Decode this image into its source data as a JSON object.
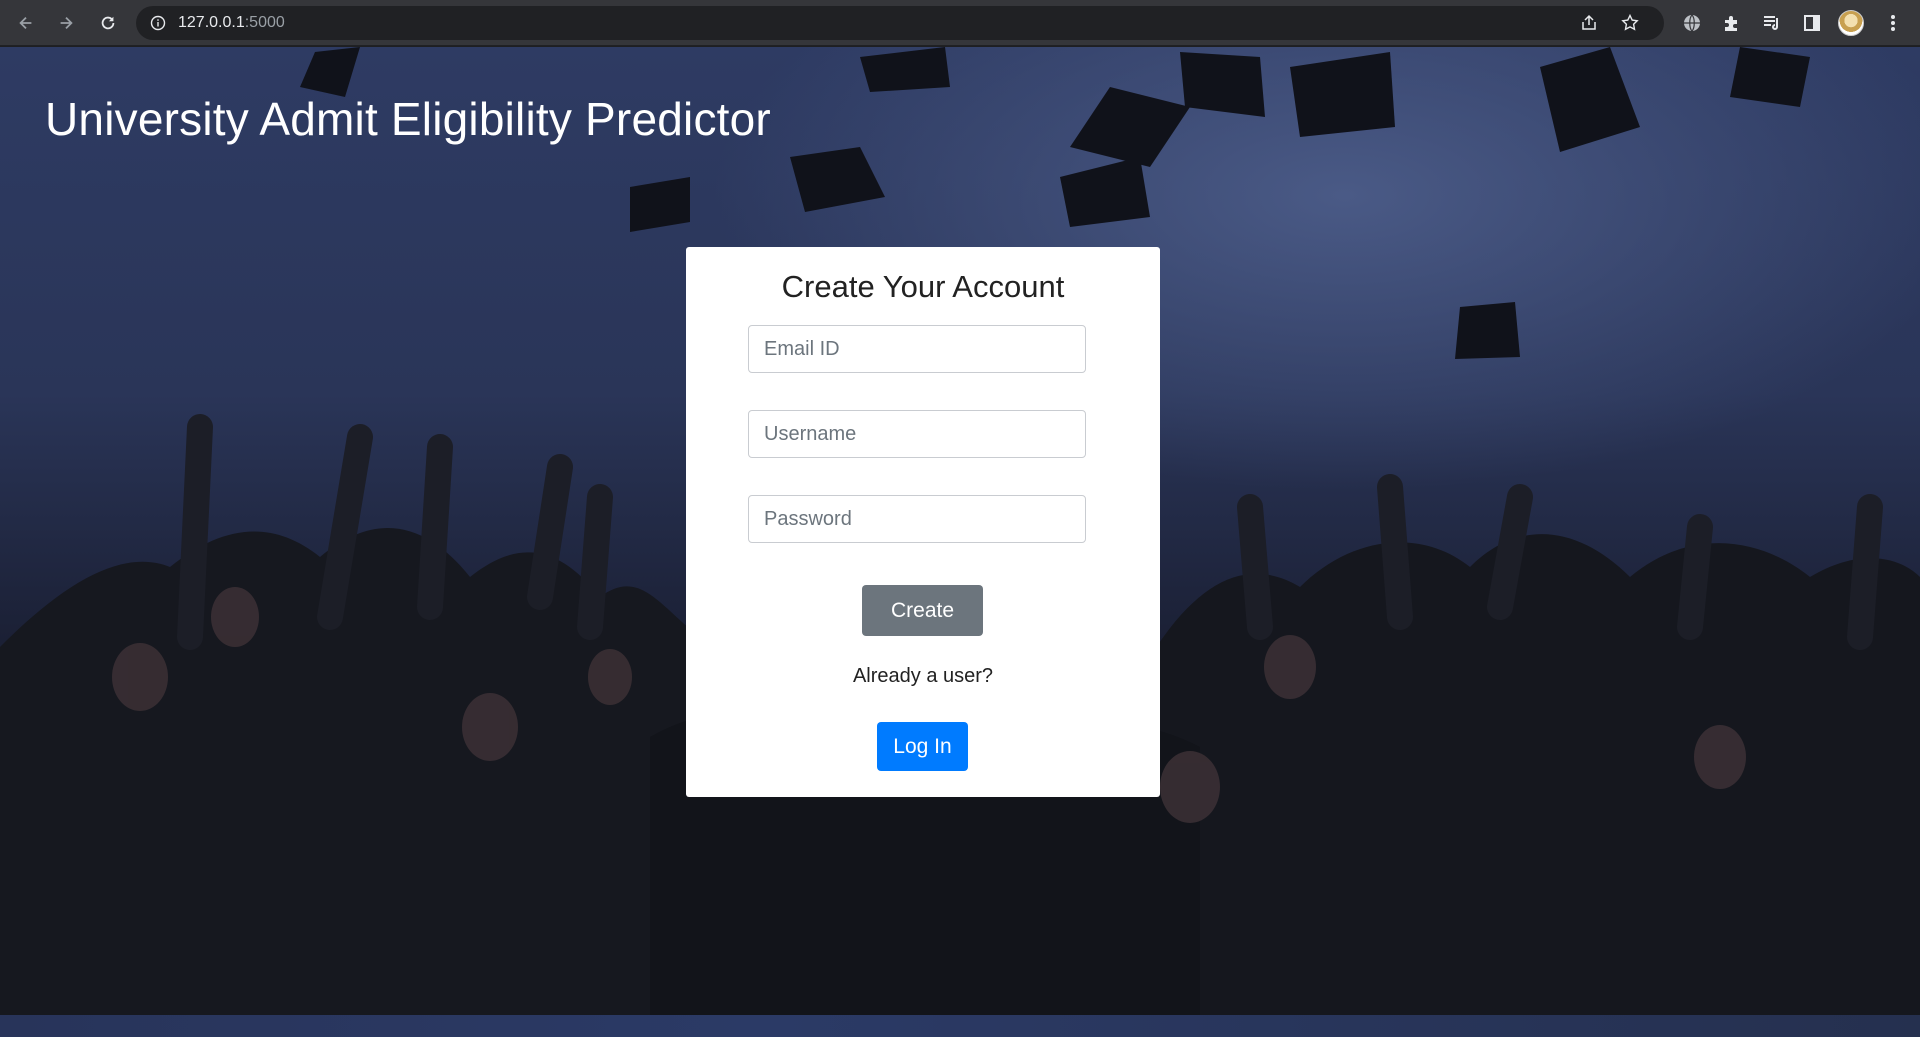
{
  "browser": {
    "url_host": "127.0.0.1",
    "url_port": ":5000",
    "icons": [
      "back-arrow-icon",
      "forward-arrow-icon",
      "reload-icon",
      "info-icon",
      "share-icon",
      "star-icon",
      "globe-icon",
      "puzzle-icon",
      "media-icon",
      "sidepanel-icon",
      "avatar",
      "kebab-menu-icon"
    ]
  },
  "page": {
    "title": "University Admit Eligibility Predictor"
  },
  "form": {
    "heading": "Create Your Account",
    "email_placeholder": "Email ID",
    "username_placeholder": "Username",
    "password_placeholder": "Password",
    "create_label": "Create",
    "already_text": "Already a user?",
    "login_label": "Log In"
  },
  "colors": {
    "primary": "#007bff",
    "secondary": "#6c757d",
    "card": "#ffffff"
  }
}
